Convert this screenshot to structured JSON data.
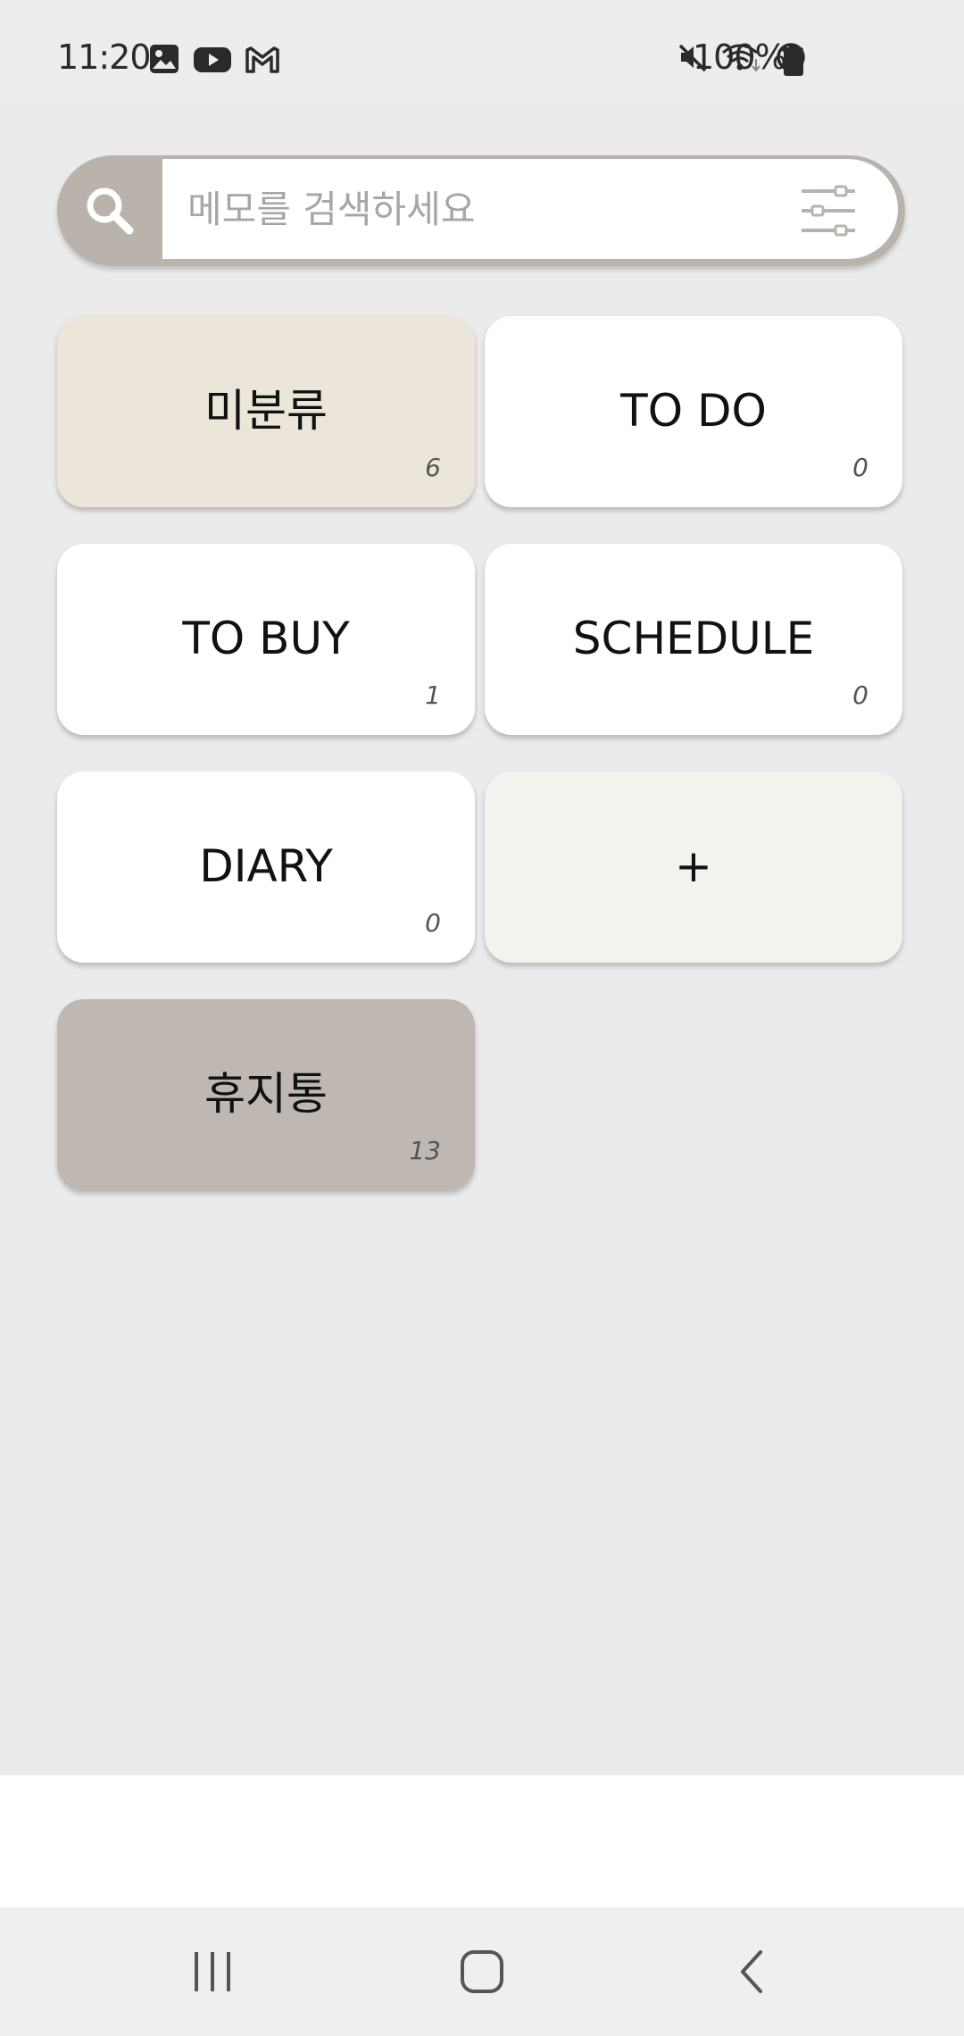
{
  "status_bar": {
    "time": "11:20",
    "battery_percent": "100%",
    "left_icons": [
      "gallery-icon",
      "youtube-icon",
      "gmail-icon"
    ],
    "right_icons": [
      "mute-icon",
      "wifi-icon",
      "do-not-disturb-icon",
      "battery-icon"
    ]
  },
  "search": {
    "placeholder": "메모를 검색하세요"
  },
  "categories": [
    {
      "label": "미분류",
      "count": "6"
    },
    {
      "label": "TO DO",
      "count": "0"
    },
    {
      "label": "TO BUY",
      "count": "1"
    },
    {
      "label": "SCHEDULE",
      "count": "0"
    },
    {
      "label": "DIARY",
      "count": "0"
    },
    {
      "label": "+"
    },
    {
      "label": "휴지통",
      "count": "13"
    }
  ],
  "colors": {
    "search_accent": "#b9b3ac",
    "uncategorized_card": "#ece5da",
    "add_card": "#f4f2ee",
    "trash_card": "#bfb8b2",
    "card_default": "#ffffff"
  },
  "nav": {
    "icons": [
      "recent-apps-icon",
      "home-icon",
      "back-icon"
    ]
  }
}
